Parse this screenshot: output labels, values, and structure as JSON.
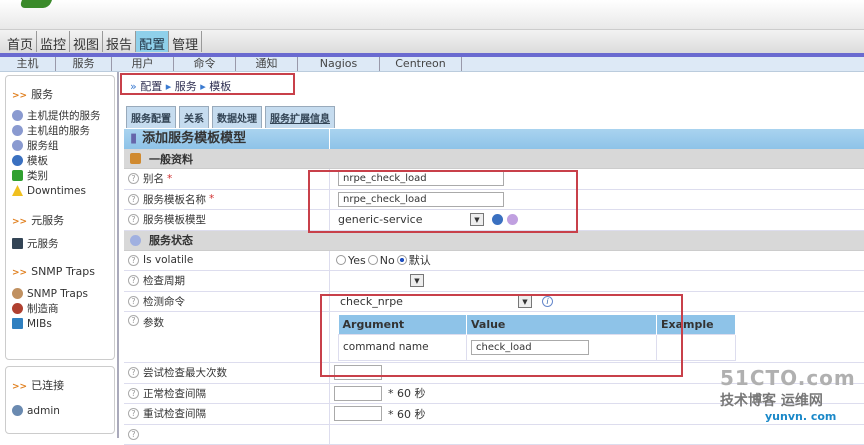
{
  "main_nav": [
    "首页",
    "监控",
    "视图",
    "报告",
    "配置",
    "管理"
  ],
  "main_nav_active": "配置",
  "sub_nav": [
    "主机",
    "服务",
    "用户",
    "命令",
    "通知",
    "Nagios",
    "Centreon"
  ],
  "breadcrumb": [
    "配置",
    "服务",
    "模板"
  ],
  "sidebar": {
    "services": {
      "title": "服务",
      "items": [
        "主机提供的服务",
        "主机组的服务",
        "服务组",
        "模板",
        "类别",
        "Downtimes"
      ]
    },
    "meta": {
      "title": "元服务",
      "items": [
        "元服务"
      ]
    },
    "snmp": {
      "title": "SNMP Traps",
      "items": [
        "SNMP Traps",
        "制造商",
        "MIBs"
      ]
    },
    "connected": {
      "title": "已连接",
      "items": [
        "admin"
      ]
    }
  },
  "tabs": [
    "服务配置",
    "关系",
    "数据处理",
    "服务扩展信息"
  ],
  "form": {
    "title": "添加服务模板模型",
    "section_general": "一般资料",
    "alias_label": "别名",
    "alias_value": "nrpe_check_load",
    "name_label": "服务模板名称",
    "name_value": "nrpe_check_load",
    "template_label": "服务模板模型",
    "template_value": "generic-service",
    "section_state": "服务状态",
    "volatile_label": "Is volatile",
    "opt_yes": "Yes",
    "opt_no": "No",
    "opt_default": "默认",
    "period_label": "检查周期",
    "command_label": "检测命令",
    "command_value": "check_nrpe",
    "args_label": "参数",
    "args_headers": [
      "Argument",
      "Value",
      "Example"
    ],
    "args_row": {
      "argument": "command name",
      "value": "check_load"
    },
    "max_attempts_label": "尝试检查最大次数",
    "normal_interval_label": "正常检查间隔",
    "retry_interval_label": "重试检查间隔",
    "interval_unit": "* 60 秒",
    "required_mark": "*"
  },
  "watermark": {
    "line1": "51CTO.com",
    "line2": "技术博客 运维网",
    "line3": "yunvn. com"
  },
  "colors": {
    "accent": "#8ec3e8",
    "highlight": "#c8404a"
  }
}
